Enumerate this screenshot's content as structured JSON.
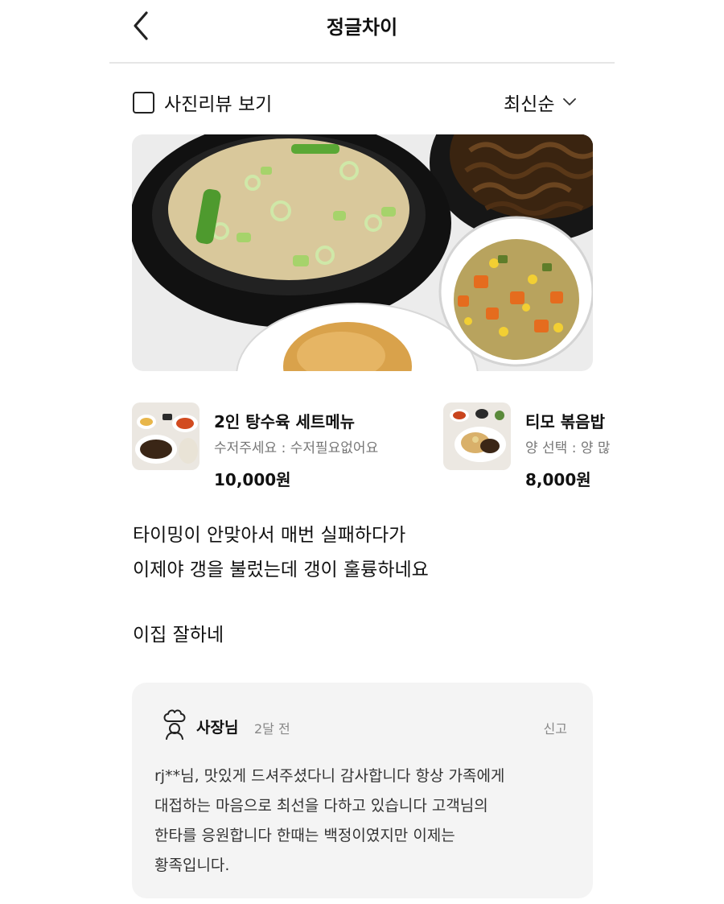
{
  "header": {
    "title": "정글차이",
    "back_icon": "chevron-left-icon"
  },
  "filter": {
    "photo_review_label": "사진리뷰 보기",
    "photo_review_checked": false,
    "sort_label": "최신순",
    "sort_icon": "chevron-down-icon"
  },
  "review": {
    "photo": "food-photo",
    "menu_items": [
      {
        "name": "2인 탕수육 세트메뉴",
        "option": "수저주세요 : 수저필요없어요",
        "price": "10,000원"
      },
      {
        "name": "티모 볶음밥",
        "option": "양 선택 : 양 많",
        "price": "8,000원"
      }
    ],
    "body_lines": [
      "타이밍이 안맞아서 매번 실패하다가",
      "이제야 갱을 불렀는데 갱이 훌륭하네요"
    ],
    "extra_line": "이집 잘하네"
  },
  "owner_reply": {
    "icon": "chef-hat-icon",
    "author": "사장님",
    "date": "2달 전",
    "report_label": "신고",
    "lines": [
      "rj**님, 맛있게 드셔주셨다니 감사합니다 항상 가족에게",
      "대접하는 마음으로 최선을 다하고 있습니다 고객님의",
      "한타를 응원합니다 한때는 백정이였지만 이제는",
      "황족입니다."
    ]
  },
  "colors": {
    "text": "#111111",
    "muted": "#888888",
    "reply_bg": "#f4f4f4",
    "divider": "#e6e6e6"
  }
}
